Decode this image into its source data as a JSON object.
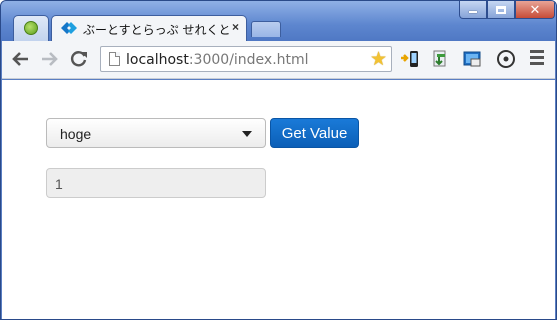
{
  "browser": {
    "active_tab": {
      "title": "ぶーとすとらっぷ せれくと",
      "close_glyph": "×"
    },
    "address_bar": {
      "host": "localhost",
      "path": ":3000/index.html"
    },
    "icons": {
      "back": "back-arrow-icon",
      "forward": "forward-arrow-icon",
      "reload": "reload-icon",
      "bookmark": "star-icon",
      "menu": "hamburger-menu-icon"
    },
    "window_controls": {
      "close_glyph": "✕"
    },
    "star_glyph": "★"
  },
  "page": {
    "select": {
      "value": "hoge"
    },
    "get_value_button": {
      "label": "Get Value"
    },
    "value_field": {
      "value": "1"
    }
  },
  "colors": {
    "primary_button": "#0b63c5",
    "frame": "#5a7ec2"
  }
}
